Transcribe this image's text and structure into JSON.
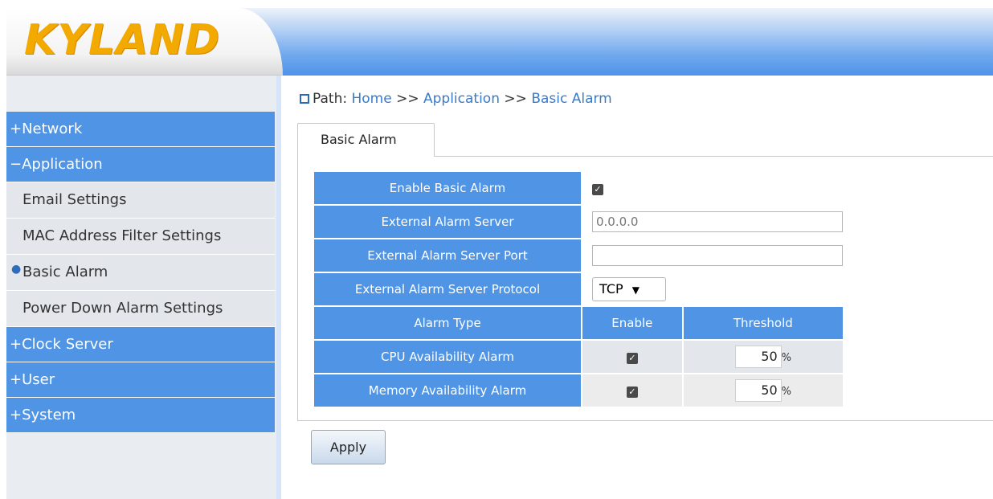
{
  "brand": {
    "logo_text": "KYLAND"
  },
  "sidebar": {
    "items": [
      {
        "label": "+Network",
        "kind": "category"
      },
      {
        "label": "−Application",
        "kind": "category"
      },
      {
        "label": "Email Settings",
        "kind": "sub"
      },
      {
        "label": "MAC Address Filter Settings",
        "kind": "sub"
      },
      {
        "label": "Basic Alarm",
        "kind": "sub",
        "active": true
      },
      {
        "label": "Power Down Alarm Settings",
        "kind": "sub"
      },
      {
        "label": "+Clock Server",
        "kind": "category"
      },
      {
        "label": "+User",
        "kind": "category"
      },
      {
        "label": "+System",
        "kind": "category"
      }
    ]
  },
  "path": {
    "label": "Path:",
    "home": "Home",
    "sep1": ">>",
    "application": "Application",
    "sep2": ">>",
    "current": "Basic Alarm"
  },
  "tab": {
    "label": "Basic Alarm"
  },
  "form": {
    "enable_basic_alarm_label": "Enable Basic Alarm",
    "enable_basic_alarm_checked": true,
    "external_server_label": "External Alarm Server",
    "external_server_placeholder": "0.0.0.0",
    "external_port_label": "External Alarm Server Port",
    "external_port_value": "",
    "external_protocol_label": "External Alarm Server Protocol",
    "external_protocol_value": "TCP"
  },
  "alarm_table": {
    "headers": {
      "type": "Alarm Type",
      "enable": "Enable",
      "threshold": "Threshold"
    },
    "rows": [
      {
        "type": "CPU Availability Alarm",
        "enabled": true,
        "threshold": "50",
        "unit": "%"
      },
      {
        "type": "Memory Availability Alarm",
        "enabled": true,
        "threshold": "50",
        "unit": "%"
      }
    ]
  },
  "actions": {
    "apply_label": "Apply"
  },
  "colors": {
    "menu_blue": "#4f94e5",
    "logo_gold": "#f2a900",
    "link_blue": "#3a7bc8"
  }
}
